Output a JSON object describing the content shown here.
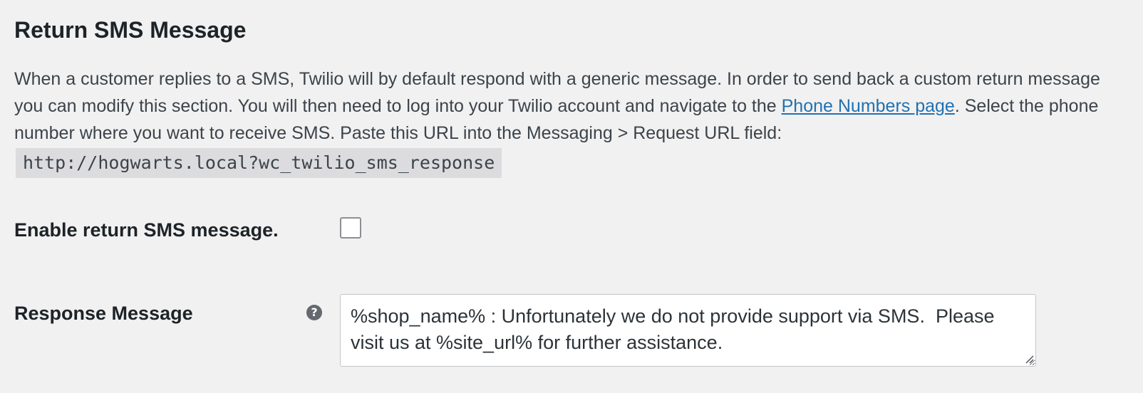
{
  "section": {
    "title": "Return SMS Message",
    "description_part1": "When a customer replies to a SMS, Twilio will by default respond with a generic message. In order to send back a custom return message you can modify this section. You will then need to log into your Twilio account and navigate to the ",
    "link_label": "Phone Numbers page",
    "description_part2": ". Select the phone number where you want to receive SMS. Paste this URL into the Messaging > Request URL field:",
    "response_url": "http://hogwarts.local?wc_twilio_sms_response"
  },
  "fields": {
    "enable": {
      "label": "Enable return SMS message.",
      "checked": false
    },
    "response_message": {
      "label": "Response Message",
      "help_icon": "question-circle-icon",
      "value": "%shop_name% : Unfortunately we do not provide support via SMS.  Please visit us at %site_url% for further assistance."
    }
  },
  "colors": {
    "background": "#f1f1f1",
    "link": "#2271b1",
    "code_background": "#dcdcde",
    "help_icon": "#646970"
  }
}
